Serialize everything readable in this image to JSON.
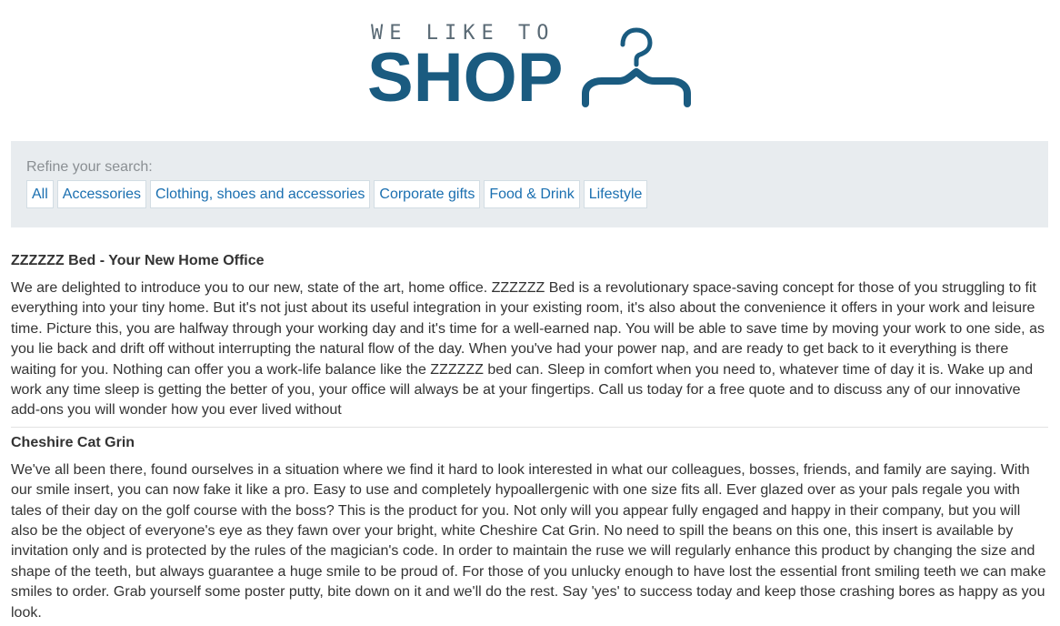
{
  "logo": {
    "tagline": "WE LIKE TO",
    "word": "SHOP",
    "icon": "hanger-icon",
    "color": "#1a5b80"
  },
  "refine": {
    "label": "Refine your search:",
    "filters": [
      "All",
      "Accessories",
      "Clothing, shoes and accessories",
      "Corporate gifts",
      "Food & Drink",
      "Lifestyle"
    ]
  },
  "posts": [
    {
      "title": "ZZZZZZ Bed - Your New Home Office",
      "body": "We are delighted to introduce you to our new, state of the art, home office. ZZZZZZ Bed is a revolutionary space-saving concept for those of you struggling to fit everything into your tiny home. But it's not just about its useful integration in your existing room, it's also about the convenience it offers in your work and leisure time. Picture this, you are halfway through your working day and it's time for a well-earned nap. You will be able to save time by moving your work to one side, as you lie back and drift off without interrupting the natural flow of the day. When you've had your power nap, and are ready to get back to it everything is there waiting for you. Nothing can offer you a work-life balance like the ZZZZZZ bed can. Sleep in comfort when you need to, whatever time of day it is. Wake up and work any time sleep is getting the better of you, your office will always be at your fingertips. Call us today for a free quote and to discuss any of our innovative add-ons you will wonder how you ever lived without"
    },
    {
      "title": "Cheshire Cat Grin",
      "body": "We've all been there, found ourselves in a situation where we find it hard to look interested in what our colleagues, bosses, friends, and family are saying. With our smile insert, you can now fake it like a pro. Easy to use and completely hypoallergenic with one size fits all. Ever glazed over as your pals regale you with tales of their day on the golf course with the boss? This is the product for you. Not only will you appear fully engaged and happy in their company, but you will also be the object of everyone's eye as they fawn over your bright, white Cheshire Cat Grin. No need to spill the beans on this one, this insert is available by invitation only and is protected by the rules of the magician's code. In order to maintain the ruse we will regularly enhance this product by changing the size and shape of the teeth, but always guarantee a huge smile to be proud of. For those of you unlucky enough to have lost the essential front smiling teeth we can make smiles to order. Grab yourself some poster putty, bite down on it and we'll do the rest. Say 'yes' to success today and keep those crashing bores as happy as you look."
    }
  ]
}
